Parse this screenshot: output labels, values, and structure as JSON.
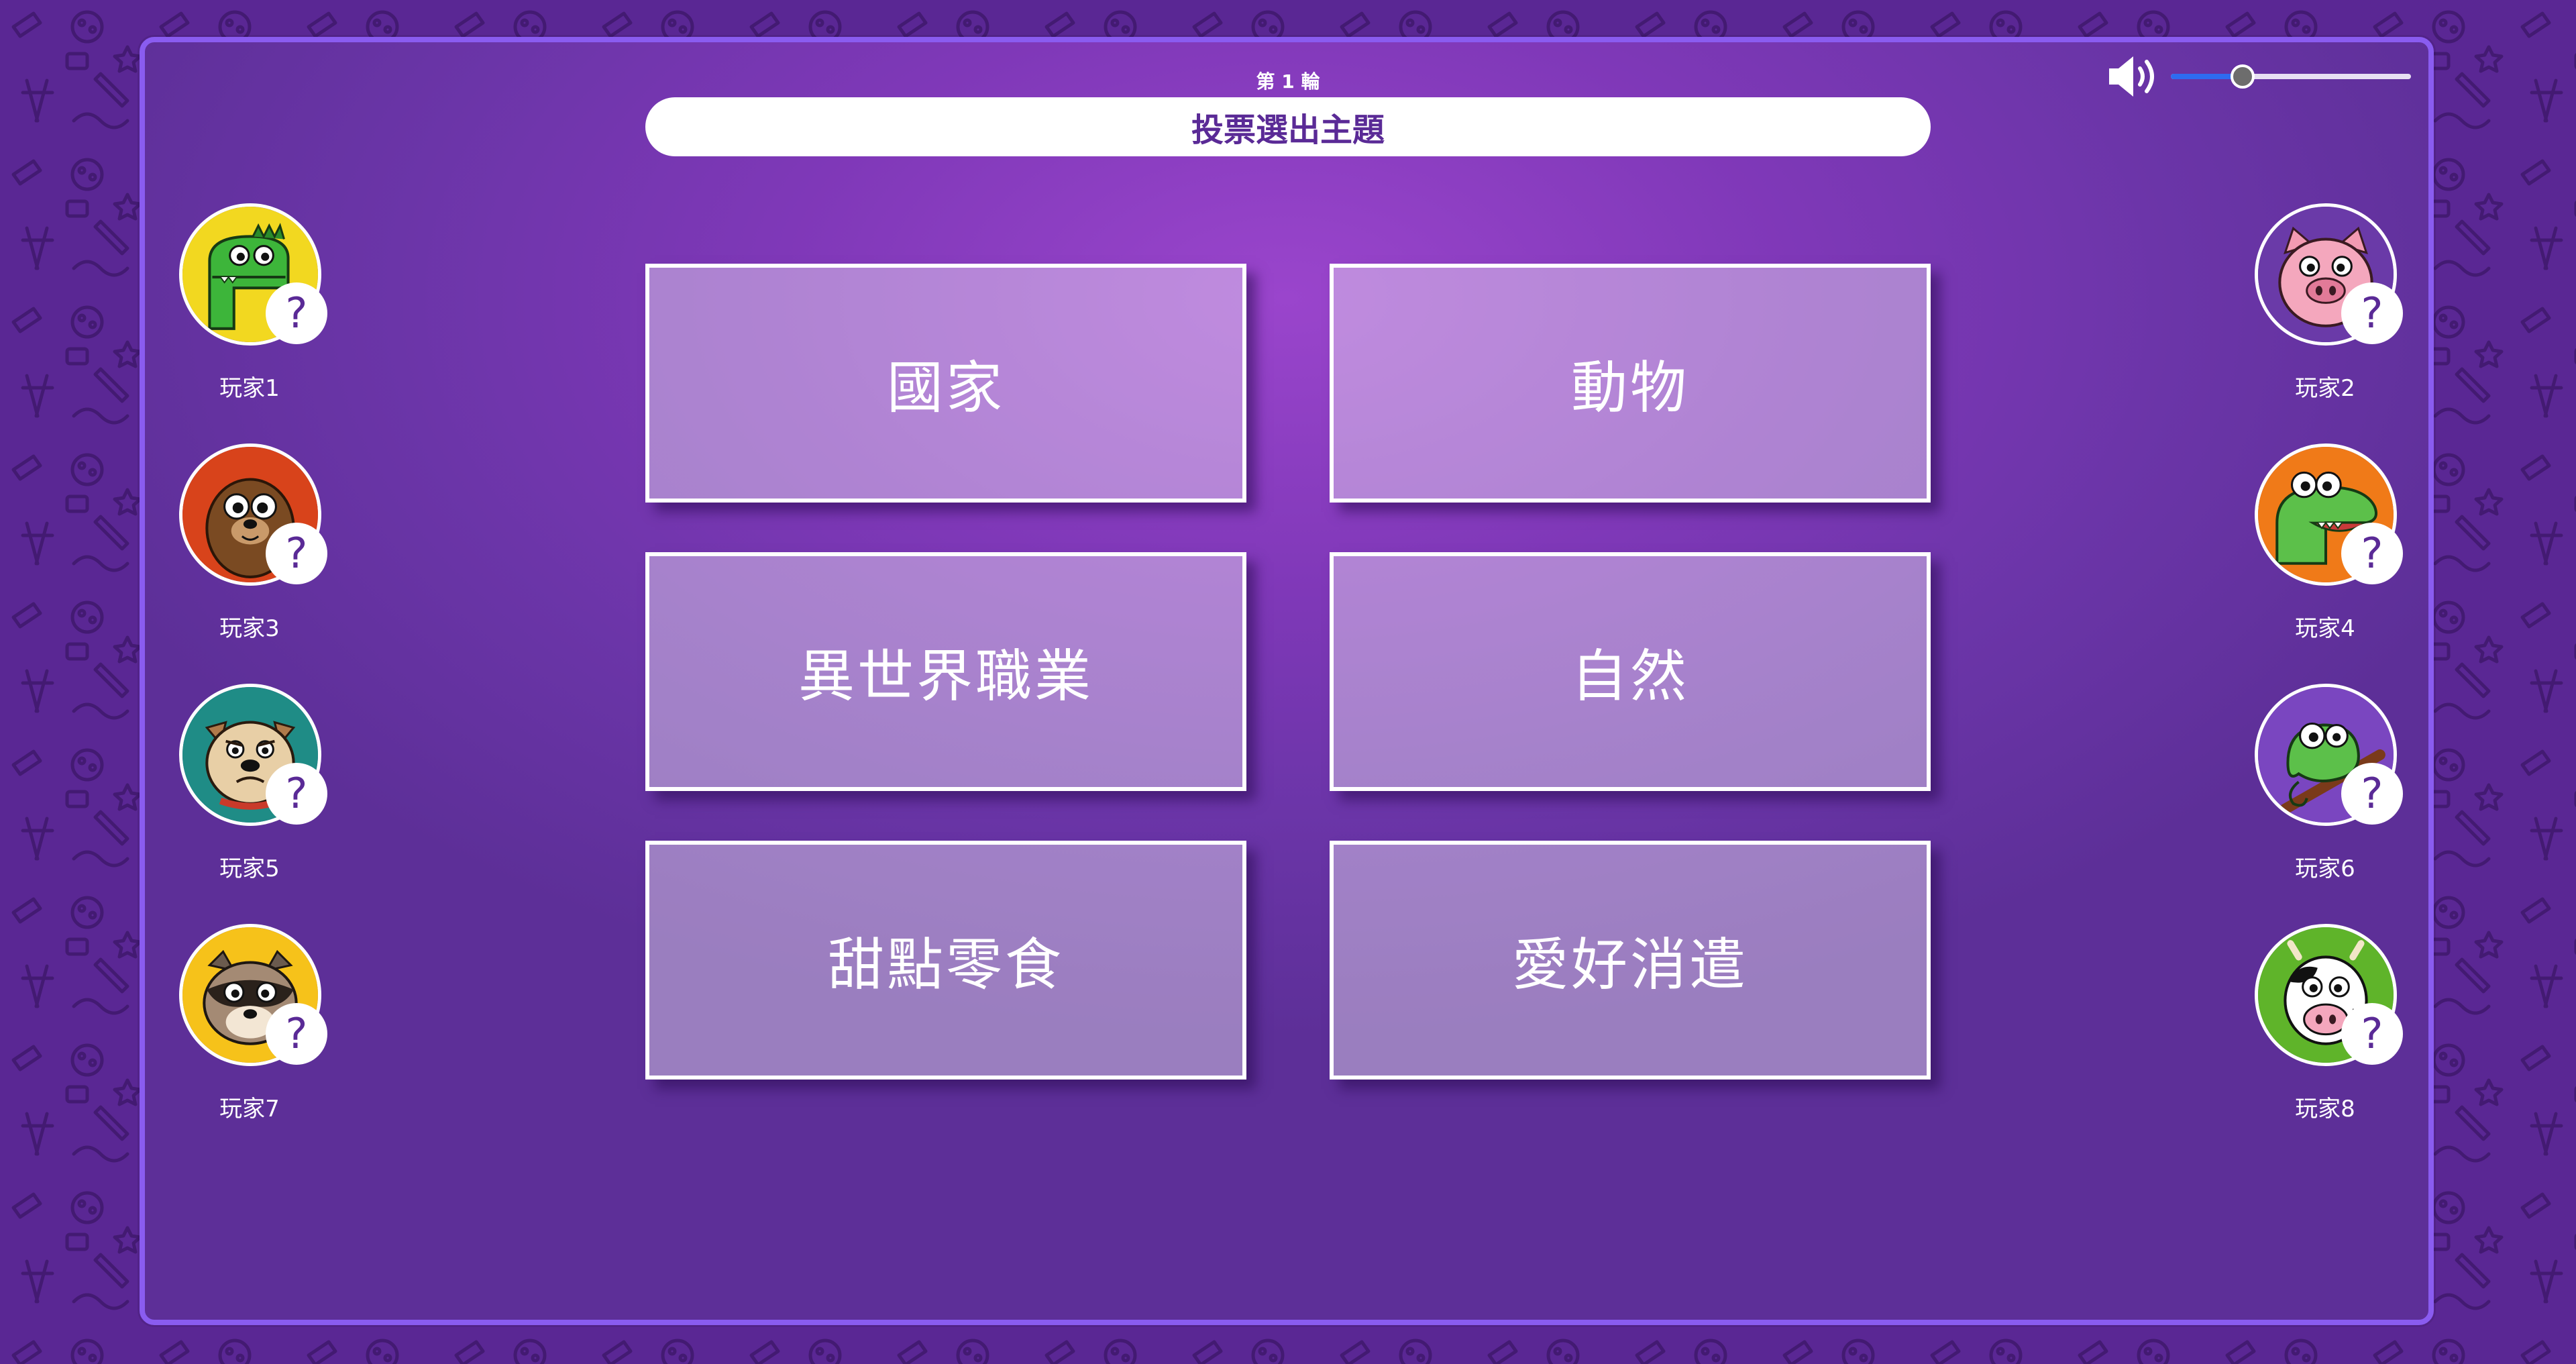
{
  "round_label": "第 1 輪",
  "title": "投票選出主題",
  "volume": {
    "icon": "speaker-icon",
    "level": 0.3
  },
  "topics": [
    "國家",
    "動物",
    "異世界職業",
    "自然",
    "甜點零食",
    "愛好消遣"
  ],
  "players": [
    {
      "name": "玩家1",
      "avatar": "dinosaur",
      "bg": "#f2d820",
      "status": "?"
    },
    {
      "name": "玩家2",
      "avatar": "pig",
      "bg": "#6a3aa8",
      "status": "?"
    },
    {
      "name": "玩家3",
      "avatar": "otter",
      "bg": "#d8431b",
      "status": "?"
    },
    {
      "name": "玩家4",
      "avatar": "crocodile",
      "bg": "#f07a18",
      "status": "?"
    },
    {
      "name": "玩家5",
      "avatar": "bulldog",
      "bg": "#1f8c86",
      "status": "?"
    },
    {
      "name": "玩家6",
      "avatar": "chameleon",
      "bg": "#7a46c0",
      "status": "?"
    },
    {
      "name": "玩家7",
      "avatar": "raccoon",
      "bg": "#f6c21a",
      "status": "?"
    },
    {
      "name": "玩家8",
      "avatar": "cow",
      "bg": "#5fb42a",
      "status": "?"
    }
  ],
  "colors": {
    "background": "#5a2794",
    "panel_border": "#8a5cf0",
    "title_text": "#5a2a96",
    "slider_fill": "#2e6bf0"
  }
}
